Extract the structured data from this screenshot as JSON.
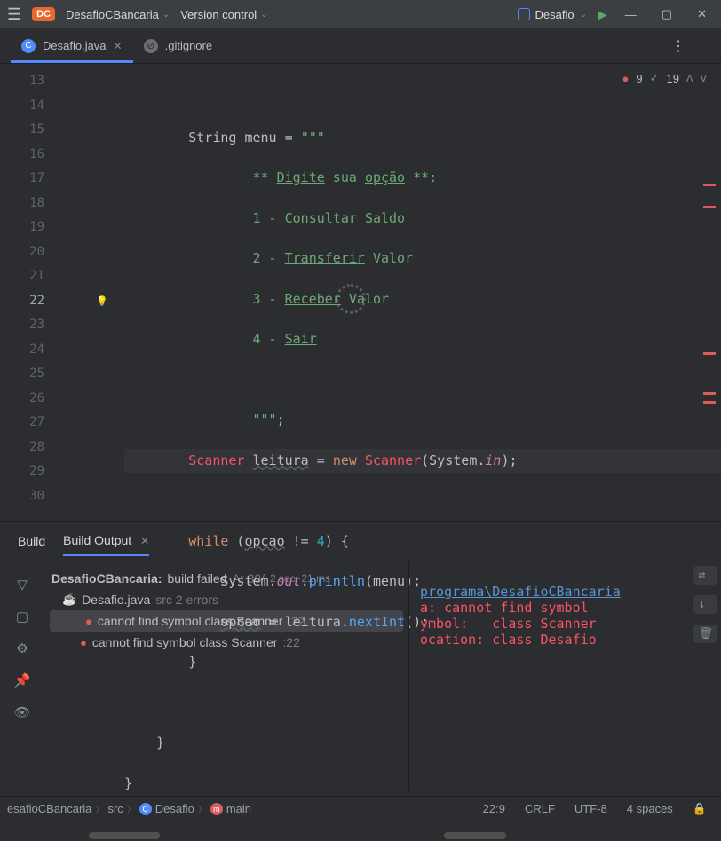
{
  "titlebar": {
    "project_badge": "DC",
    "project_name": "DesafioCBancaria",
    "vcs_menu": "Version control",
    "run_config": "Desafio"
  },
  "tabs": [
    {
      "name": "Desafio.java",
      "icon": "C",
      "active": true
    },
    {
      "name": ".gitignore",
      "icon": "⊘",
      "active": false
    }
  ],
  "inspection": {
    "errors_icon": "!",
    "errors": "9",
    "warnings_icon": "✓",
    "warnings": "19"
  },
  "editor": {
    "lines": [
      13,
      14,
      15,
      16,
      17,
      18,
      19,
      20,
      21,
      22,
      23,
      24,
      25,
      26,
      27,
      28,
      29,
      30
    ],
    "current_line": 22,
    "content": {
      "l14_pre": "        String menu = ",
      "l14_q": "\"\"\"",
      "l15": "                ** Digite sua opção **:",
      "l15_u1": "Digite",
      "l15_u2": "opção",
      "l16": "                1 - Consultar Saldo",
      "l16_u1": "Consultar",
      "l16_u2": "Saldo",
      "l17": "                2 - Transferir Valor",
      "l17_u": "Transferir",
      "l18": "                3 - Receber Valor",
      "l18_u": "Receber",
      "l19": "                4 - Sair",
      "l19_u": "Sair",
      "l21": "                \"\"\";",
      "l22_scanner": "Scanner",
      "l22_leitura": "leitura",
      "l22_eq": " = ",
      "l22_new": "new",
      "l22_scanner2": " Scanner",
      "l22_sys": "(System.",
      "l22_in": "in",
      "l22_end": ");",
      "l24_while": "        while",
      "l24_open": " (",
      "l24_opcao": "opcao",
      "l24_ne": " != ",
      "l24_4": "4",
      "l24_brace": ") {",
      "l25_sys": "            System.",
      "l25_out": "out",
      "l25_dot": ".",
      "l25_println": "println",
      "l25_end": "(menu);",
      "l26_opcao": "            opcao",
      "l26_rest": " = leitura.",
      "l26_next": "nextInt",
      "l26_end": "();",
      "l27": "        }",
      "l29": "    }",
      "l30": "}"
    }
  },
  "build": {
    "tab1": "Build",
    "tab2": "Build Output",
    "header_proj": "DesafioCBancaria:",
    "header_status": "build failed",
    "header_time": "At 30/",
    "header_dur": "2 sec, 21 ms",
    "file": "Desafio.java",
    "file_meta": "src 2 errors",
    "err1": "cannot find symbol class Scanner",
    "err1_line": ":22",
    "err2": "cannot find symbol class Scanner",
    "err2_line": ":22",
    "output": {
      "l1": "programa\\DesafioCBancaria",
      "l2": "a: cannot find symbol",
      "l3": "ymbol:   class Scanner",
      "l4": "ocation: class Desafio"
    }
  },
  "statusbar": {
    "crumb1": "esafioCBancaria",
    "crumb2": "src",
    "crumb3": "Desafio",
    "crumb4": "main",
    "pos": "22:9",
    "sep": "CRLF",
    "enc": "UTF-8",
    "indent": "4 spaces"
  }
}
